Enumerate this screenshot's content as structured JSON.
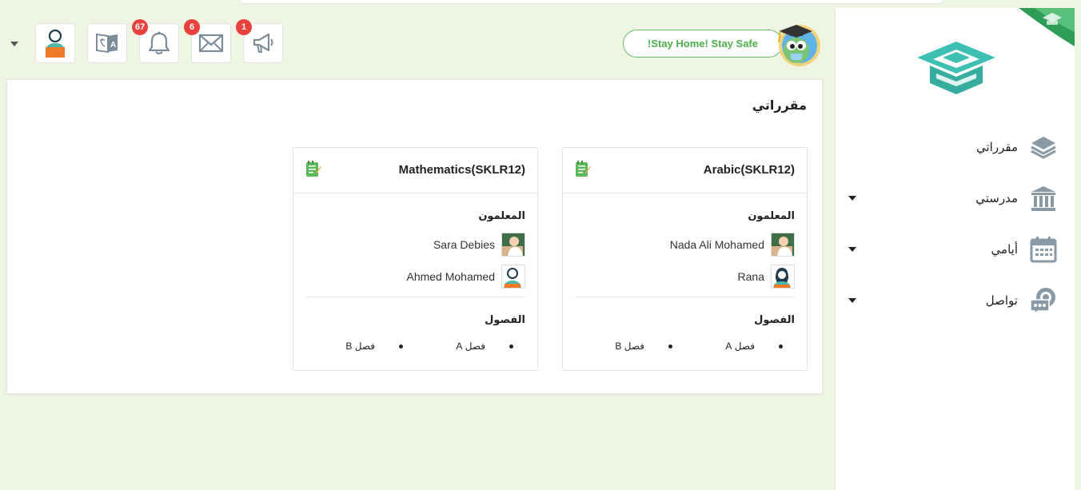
{
  "header": {
    "banner_text": "!Stay Home! Stay Safe",
    "buttons": [
      {
        "name": "announcements",
        "icon": "megaphone-icon",
        "badge": "1"
      },
      {
        "name": "messages",
        "icon": "envelope-icon",
        "badge": "6"
      },
      {
        "name": "notifications",
        "icon": "bell-icon",
        "badge": "67"
      },
      {
        "name": "language",
        "icon": "translate-icon",
        "badge": ""
      },
      {
        "name": "profile",
        "icon": "user-avatar-icon",
        "badge": ""
      }
    ]
  },
  "sidebar": {
    "items": [
      {
        "label": "مقرراتي",
        "icon": "layers-icon",
        "has_caret": false
      },
      {
        "label": "مدرستي",
        "icon": "institution-icon",
        "has_caret": true
      },
      {
        "label": "أيامي",
        "icon": "calendar-icon",
        "has_caret": true
      },
      {
        "label": "تواصل",
        "icon": "chat-bubbles-icon",
        "has_caret": true
      }
    ]
  },
  "main": {
    "title": "مقرراتي",
    "courses": [
      {
        "title": "Arabic(SKLR12)",
        "teachers_label": "المعلمون",
        "teachers": [
          {
            "name": "Nada Ali Mohamed",
            "avatar": "teacher-photo"
          },
          {
            "name": "Rana",
            "avatar": "female-teacher-avatar"
          }
        ],
        "classes_label": "الفصول",
        "classes": [
          "فصل A",
          "فصل B"
        ]
      },
      {
        "title": "Mathematics(SKLR12)",
        "teachers_label": "المعلمون",
        "teachers": [
          {
            "name": "Sara Debies",
            "avatar": "teacher-photo"
          },
          {
            "name": "Ahmed Mohamed",
            "avatar": "male-teacher-avatar"
          }
        ],
        "classes_label": "الفصول",
        "classes": [
          "فصل A",
          "فصل B"
        ]
      }
    ]
  },
  "colors": {
    "background": "#eff5e3",
    "accent_green": "#4cae4c",
    "badge_red": "#e8413e",
    "logo_teal": "#3dbfb1"
  }
}
